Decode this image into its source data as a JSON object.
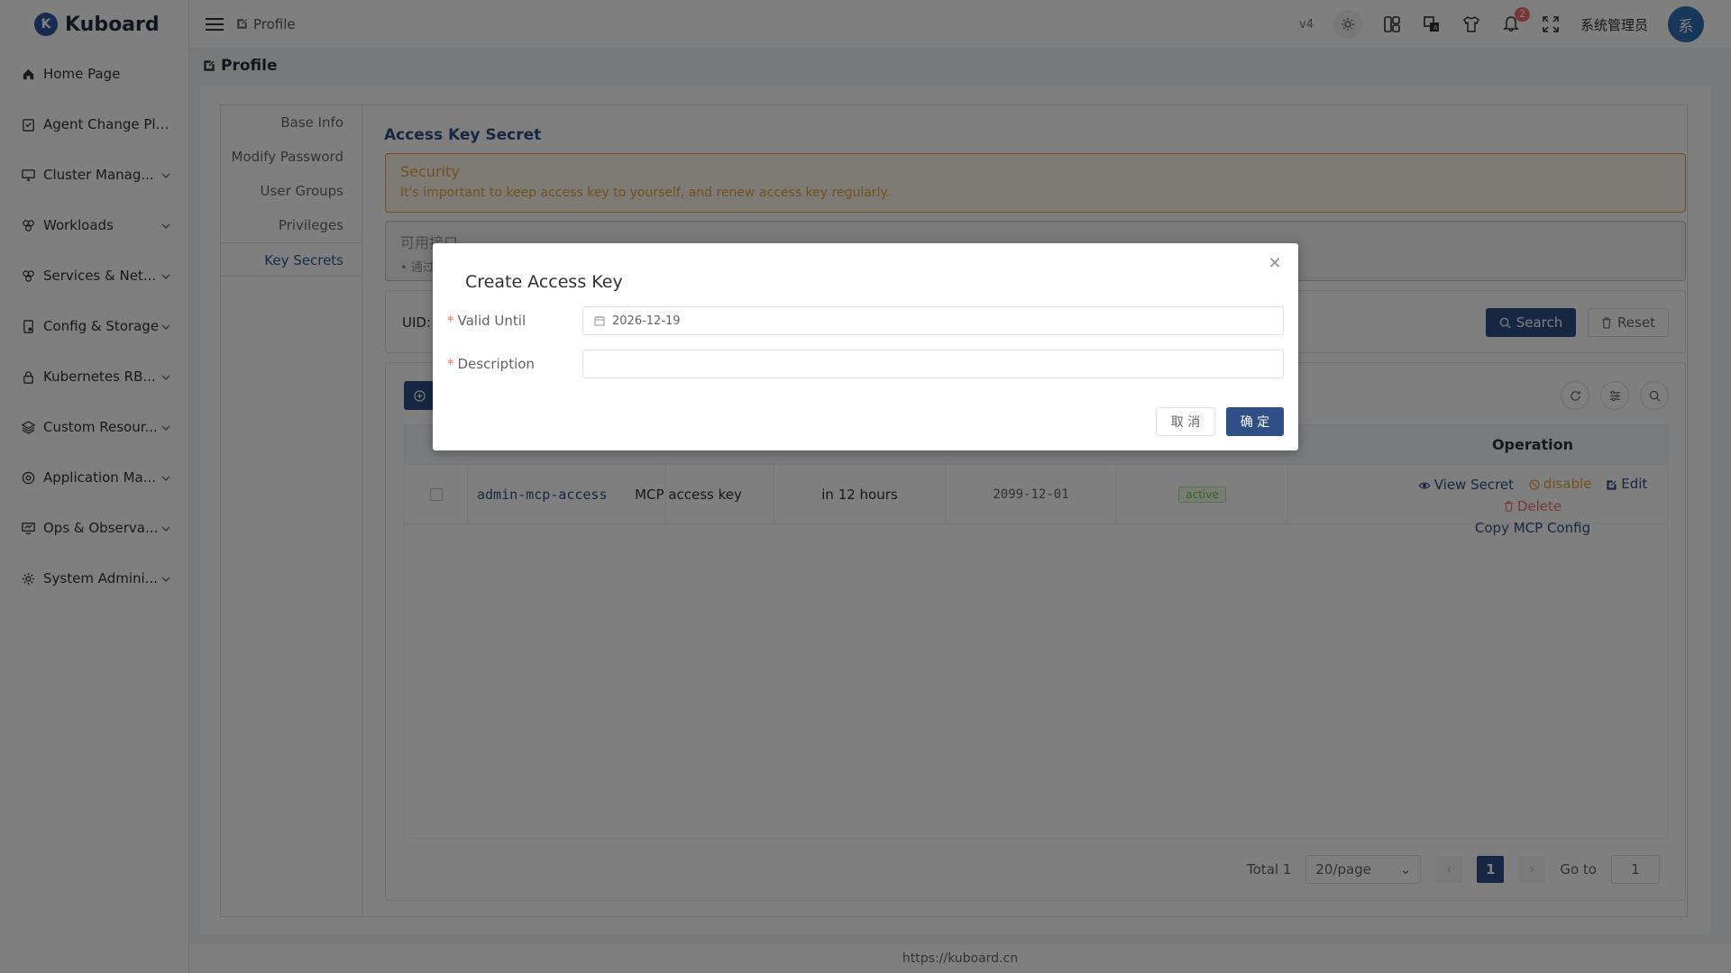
{
  "app": {
    "logo_letter": "K",
    "name": "Kuboard"
  },
  "sidebar": {
    "items": [
      {
        "label": "Home Page",
        "icon": "home-icon",
        "expandable": false
      },
      {
        "label": "Agent Change Plans",
        "icon": "clipboard-icon",
        "expandable": false
      },
      {
        "label": "Cluster Manag...",
        "icon": "monitor-icon",
        "expandable": true
      },
      {
        "label": "Workloads",
        "icon": "workloads-icon",
        "expandable": true
      },
      {
        "label": "Services & Net...",
        "icon": "network-icon",
        "expandable": true
      },
      {
        "label": "Config & Storage",
        "icon": "config-icon",
        "expandable": true
      },
      {
        "label": "Kubernetes RB...",
        "icon": "lock-icon",
        "expandable": true
      },
      {
        "label": "Custom Resour...",
        "icon": "layers-icon",
        "expandable": true
      },
      {
        "label": "Application Ma...",
        "icon": "app-icon",
        "expandable": true
      },
      {
        "label": "Ops & Observa...",
        "icon": "ops-icon",
        "expandable": true
      },
      {
        "label": "System Admini...",
        "icon": "gear-icon",
        "expandable": true
      }
    ]
  },
  "header": {
    "breadcrumb": "Profile",
    "version": "v4",
    "notification_count": "2",
    "user_name": "系统管理员",
    "avatar_text": "系"
  },
  "page": {
    "title": "Profile"
  },
  "profile_tabs": [
    "Base Info",
    "Modify Password",
    "User Groups",
    "Privileges",
    "Key Secrets"
  ],
  "active_tab": "Key Secrets",
  "section": {
    "title": "Access Key Secret"
  },
  "security_alert": {
    "title": "Security",
    "description": "It's important to keep access key to yourself, and renew access key regularly."
  },
  "info_alert": {
    "title": "可用接口",
    "description": "通过"
  },
  "search": {
    "uid_label": "UID:",
    "search_label": "Search",
    "reset_label": "Reset"
  },
  "table": {
    "operation_header": "Operation",
    "rows": [
      {
        "name": "admin-mcp-access",
        "description": "MCP access key",
        "expires": "in 12 hours",
        "valid_until": "2099-12-01",
        "status": "active",
        "ops": {
          "view": "View Secret",
          "disable": "disable",
          "edit": "Edit",
          "delete": "Delete",
          "copy": "Copy MCP Config"
        }
      }
    ]
  },
  "pagination": {
    "total": "Total 1",
    "page_size": "20/page",
    "current_page": "1",
    "goto_label": "Go to",
    "goto_value": "1"
  },
  "footer": {
    "text": "https://kuboard.cn"
  },
  "modal": {
    "title": "Create Access Key",
    "valid_until_label": "Valid Until",
    "valid_until_value": "2026-12-19",
    "description_label": "Description",
    "description_value": "",
    "cancel_label": "取 消",
    "ok_label": "确 定"
  },
  "colors": {
    "primary": "#2f4f86",
    "warning": "#e6a23c",
    "danger": "#f56c6c",
    "success": "#67c23a"
  }
}
